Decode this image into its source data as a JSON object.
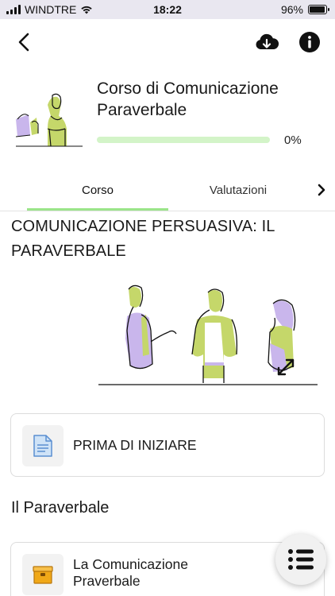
{
  "status_bar": {
    "carrier": "WINDTRE",
    "time": "18:22",
    "battery_percent": "96%",
    "battery_level": 0.96,
    "signal_bars": 4,
    "wifi": true
  },
  "nav": {
    "back_icon": "chevron-left-icon",
    "download_icon": "cloud-download-icon",
    "info_icon": "info-icon"
  },
  "course": {
    "title": "Corso di Comunicazione Paraverbale",
    "progress_text": "0%",
    "progress_value": 0
  },
  "tabs": {
    "items": [
      {
        "label": "Corso",
        "active": true
      },
      {
        "label": "Valutazioni",
        "active": false
      }
    ],
    "next_icon": "chevron-right-icon"
  },
  "content": {
    "section_title": "COMUNICAZIONE PERSUASIVA: IL PARAVERBALE",
    "expand_icon": "expand-arrows-icon",
    "cards": [
      {
        "label": "PRIMA DI INIZIARE",
        "icon": "document-icon"
      },
      {
        "label": "La Comunicazione Praverbale",
        "icon": "package-icon"
      }
    ],
    "subsection_title": "Il Paraverbale"
  },
  "fab": {
    "icon": "list-menu-icon"
  },
  "colors": {
    "status_bar_bg": "#e9e7f0",
    "accent_green": "#9be58a",
    "progress_track": "#d3f4c8",
    "illustration_lime": "#c5d76a",
    "illustration_purple": "#c9b6ec"
  }
}
